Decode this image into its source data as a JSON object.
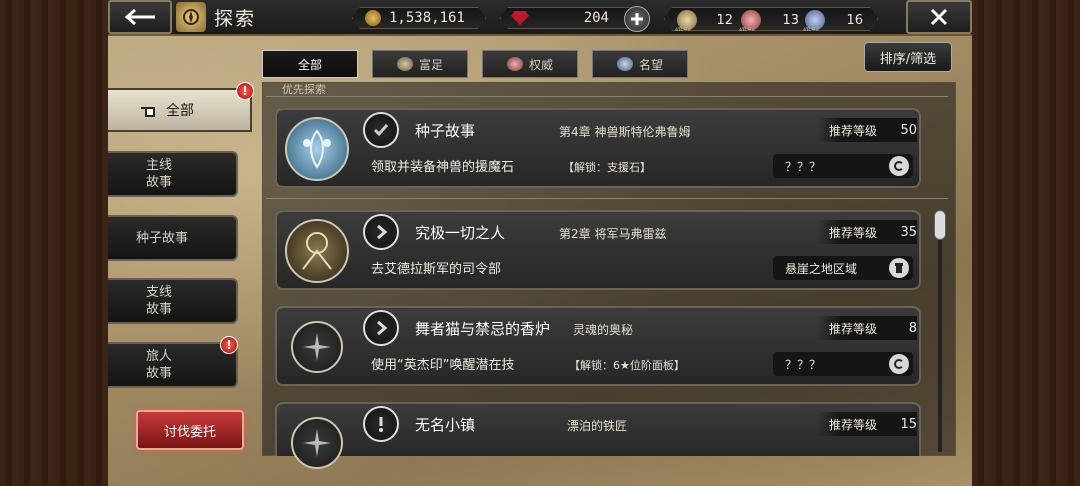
{
  "header": {
    "title": "探索",
    "coins": "1,538,161",
    "gems": "204",
    "ranks": [
      {
        "caption": "级别",
        "value": "12",
        "icon": "wealth-rank-icon"
      },
      {
        "caption": "级别",
        "value": "13",
        "icon": "authority-rank-icon"
      },
      {
        "caption": "级别",
        "value": "16",
        "icon": "fame-rank-icon"
      }
    ]
  },
  "filters": {
    "tabs": [
      {
        "label": "全部",
        "active": true
      },
      {
        "label": "富足",
        "icon": "wealth-icon"
      },
      {
        "label": "权威",
        "icon": "authority-icon"
      },
      {
        "label": "名望",
        "icon": "fame-icon"
      }
    ],
    "sort_label": "排序/筛选"
  },
  "sidebar": {
    "all_label": "全部",
    "items": [
      {
        "label": "主线\n故事"
      },
      {
        "label": "种子故事"
      },
      {
        "label": "支线\n故事"
      },
      {
        "label": "旅人\n故事"
      }
    ],
    "badge": "!",
    "request_label": "讨伐委托"
  },
  "list": {
    "section_label": "优先探索",
    "level_label": "推荐等级",
    "entries": [
      {
        "title": "种子故事",
        "chapter": "第4章  神兽斯特伦弗鲁姆",
        "level": "50",
        "desc": "领取并装备神兽的援魔石",
        "unlock": "【解锁：支援石】",
        "info": "？？？",
        "accent": "#5a8aa8"
      },
      {
        "title": "究极一切之人",
        "chapter": "第2章  将军马弗雷兹",
        "level": "35",
        "desc": "去艾德拉斯军的司令部",
        "unlock": "",
        "info": "悬崖之地区域",
        "accent": "#a8986a"
      },
      {
        "title": "舞者猫与禁忌的香炉",
        "chapter": "灵魂的奥秘",
        "level": "8",
        "desc": "使用“英杰印”唤醒潜在技",
        "unlock": "【解锁：6★位阶面板】",
        "info": "？？？",
        "accent": "#444444"
      },
      {
        "title": "无名小镇",
        "chapter": "漂泊的铁匠",
        "level": "15",
        "desc": "",
        "unlock": "",
        "info": "",
        "accent": "#444444"
      }
    ]
  }
}
